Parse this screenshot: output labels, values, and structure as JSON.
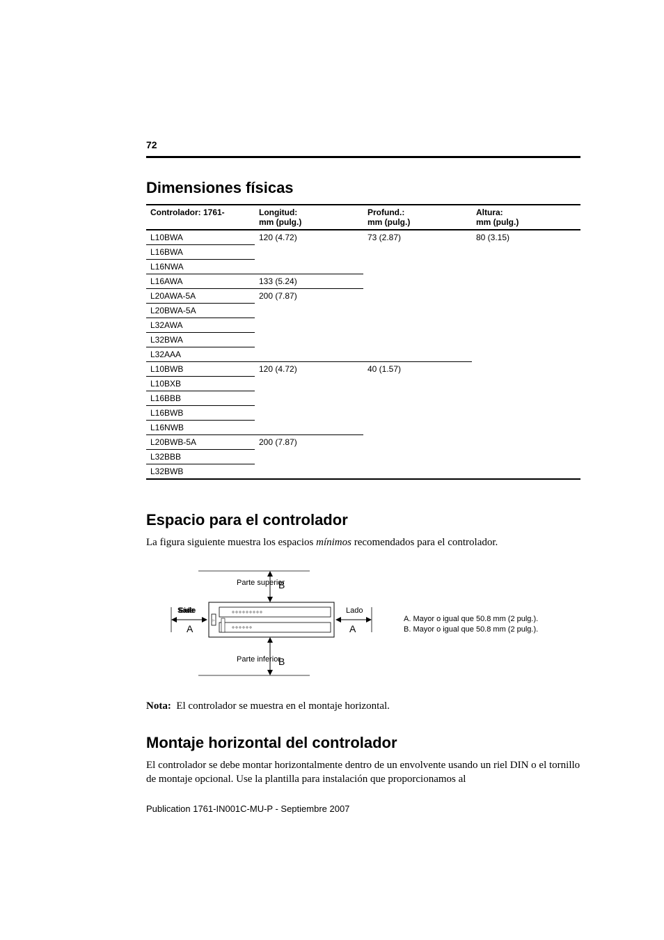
{
  "page_number": "72",
  "section1": {
    "heading": "Dimensiones físicas",
    "table": {
      "headers": {
        "col1a": "Controlador: 1761-",
        "col1b": "",
        "col2a": "Longitud:",
        "col2b": "mm (pulg.)",
        "col3a": "Profund.:",
        "col3b": "mm (pulg.)",
        "col4a": "Altura:",
        "col4b": "mm (pulg.)"
      },
      "rows": [
        {
          "c": "L10BWA",
          "l": "120 (4.72)",
          "p": "73 (2.87)",
          "a": "80 (3.15)"
        },
        {
          "c": "L16BWA",
          "l": "",
          "p": "",
          "a": ""
        },
        {
          "c": "L16NWA",
          "l": "",
          "p": "",
          "a": ""
        },
        {
          "c": "L16AWA",
          "l": "133 (5.24)",
          "p": "",
          "a": ""
        },
        {
          "c": "L20AWA-5A",
          "l": "200 (7.87)",
          "p": "",
          "a": ""
        },
        {
          "c": "L20BWA-5A",
          "l": "",
          "p": "",
          "a": ""
        },
        {
          "c": "L32AWA",
          "l": "",
          "p": "",
          "a": ""
        },
        {
          "c": "L32BWA",
          "l": "",
          "p": "",
          "a": ""
        },
        {
          "c": "L32AAA",
          "l": "",
          "p": "",
          "a": ""
        },
        {
          "c": "L10BWB",
          "l": "120 (4.72)",
          "p": "40 (1.57)",
          "a": ""
        },
        {
          "c": "L10BXB",
          "l": "",
          "p": "",
          "a": ""
        },
        {
          "c": "L16BBB",
          "l": "",
          "p": "",
          "a": ""
        },
        {
          "c": "L16BWB",
          "l": "",
          "p": "",
          "a": ""
        },
        {
          "c": "L16NWB",
          "l": "",
          "p": "",
          "a": ""
        },
        {
          "c": "L20BWB-5A",
          "l": "200 (7.87)",
          "p": "",
          "a": ""
        },
        {
          "c": "L32BBB",
          "l": "",
          "p": "",
          "a": ""
        },
        {
          "c": "L32BWB",
          "l": "",
          "p": "",
          "a": ""
        }
      ]
    }
  },
  "section2": {
    "heading": "Espacio para el controlador",
    "intro_pre": "La figura siguiente muestra los espacios ",
    "intro_italic": "mínimos",
    "intro_post": " recomendados para el controlador.",
    "labels": {
      "top": "Parte superior",
      "bottom": "Parte inferior",
      "side_left": "Sade",
      "side_struck": "Side",
      "side_right": "Lado",
      "A": "A",
      "B": "B"
    },
    "legend_a": "A. Mayor o igual que 50.8 mm (2 pulg.).",
    "legend_b": "B. Mayor o igual que 50.8 mm (2 pulg.).",
    "note_label": "Nota:",
    "note_text": "El controlador se muestra en el montaje horizontal."
  },
  "section3": {
    "heading": "Montaje horizontal del controlador",
    "para": "El controlador se debe montar horizontalmente dentro de un envolvente usando un riel DIN o el tornillo de montaje opcional.  Use la plantilla para instalación que proporcionamos al"
  },
  "footer": "Publication 1761-IN001C-MU-P - Septiembre 2007"
}
